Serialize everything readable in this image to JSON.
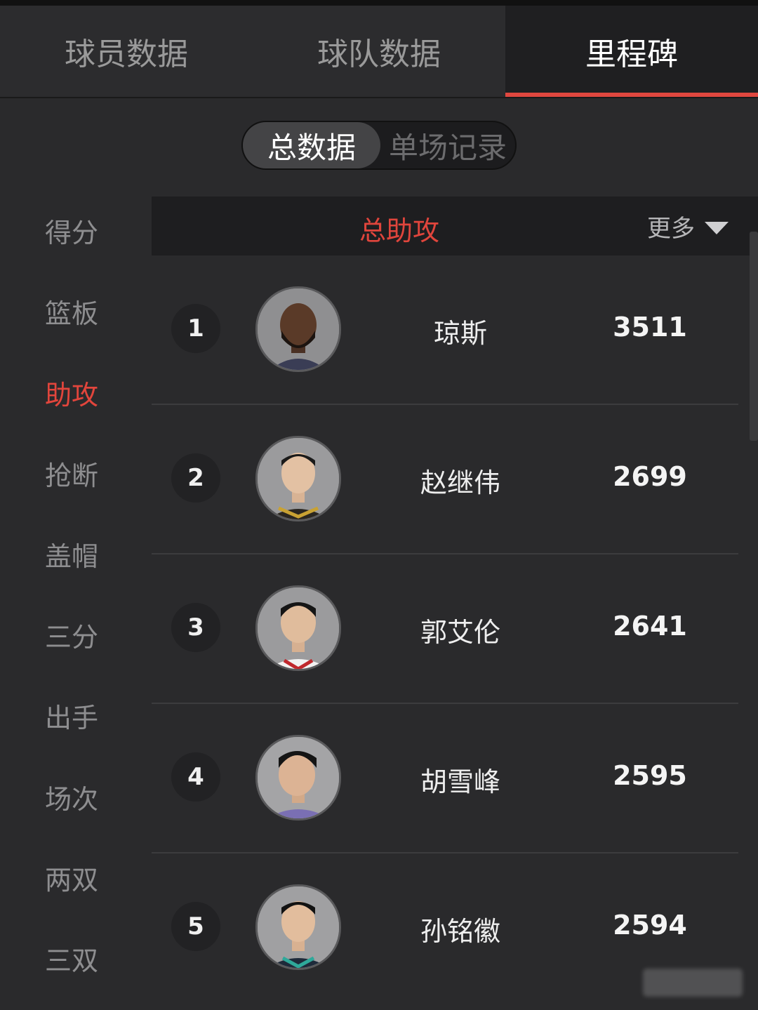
{
  "tabs": [
    {
      "label": "球员数据"
    },
    {
      "label": "球队数据"
    },
    {
      "label": "里程碑"
    }
  ],
  "segment": {
    "left": "总数据",
    "right": "单场记录"
  },
  "sidebar": {
    "items": [
      {
        "label": "得分"
      },
      {
        "label": "篮板"
      },
      {
        "label": "助攻"
      },
      {
        "label": "抢断"
      },
      {
        "label": "盖帽"
      },
      {
        "label": "三分"
      },
      {
        "label": "出手"
      },
      {
        "label": "场次"
      },
      {
        "label": "两双"
      },
      {
        "label": "三双"
      }
    ]
  },
  "header": {
    "title": "总助攻",
    "more": "更多"
  },
  "rows": [
    {
      "rank": "1",
      "name": "琼斯",
      "value": "3511"
    },
    {
      "rank": "2",
      "name": "赵继伟",
      "value": "2699"
    },
    {
      "rank": "3",
      "name": "郭艾伦",
      "value": "2641"
    },
    {
      "rank": "4",
      "name": "胡雪峰",
      "value": "2595"
    },
    {
      "rank": "5",
      "name": "孙铭徽",
      "value": "2594"
    }
  ],
  "colors": {
    "accent": "#e0473f",
    "background": "#2a2a2c"
  }
}
